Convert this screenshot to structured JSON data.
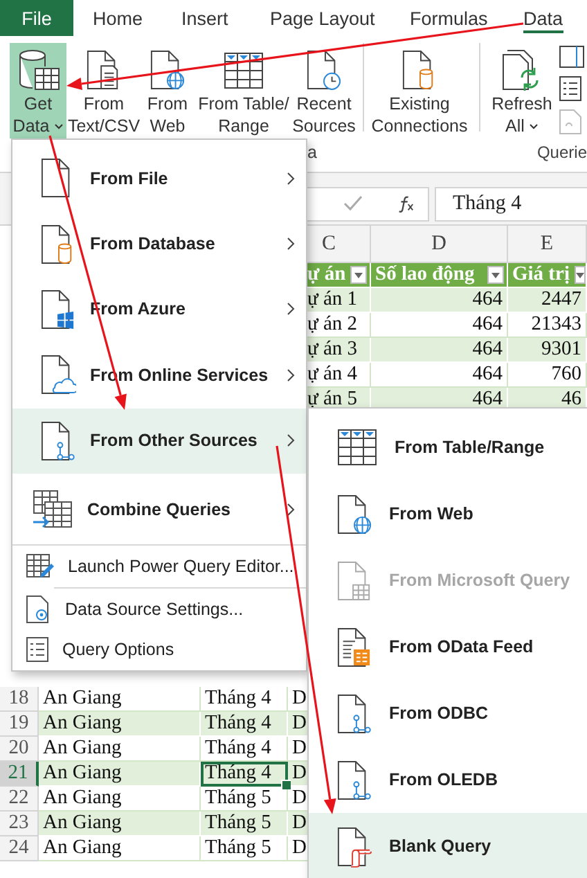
{
  "ribbon_tabs": [
    {
      "label": "File",
      "kind": "backstage",
      "selected": false
    },
    {
      "label": "Home",
      "kind": "tab",
      "selected": false
    },
    {
      "label": "Insert",
      "kind": "tab",
      "selected": false
    },
    {
      "label": "Page Layout",
      "kind": "tab",
      "selected": false
    },
    {
      "label": "Formulas",
      "kind": "tab",
      "selected": false
    },
    {
      "label": "Data",
      "kind": "tab",
      "selected": true
    }
  ],
  "ribbon": {
    "buttons": [
      {
        "lines": [
          "Get",
          "Data"
        ],
        "dropdown": true,
        "selected": true
      },
      {
        "lines": [
          "From",
          "Text/CSV"
        ],
        "dropdown": false,
        "selected": false
      },
      {
        "lines": [
          "From",
          "Web"
        ],
        "dropdown": false,
        "selected": false
      },
      {
        "lines": [
          "From Table/",
          "Range"
        ],
        "dropdown": false,
        "selected": false
      },
      {
        "lines": [
          "Recent",
          "Sources"
        ],
        "dropdown": false,
        "selected": false
      },
      {
        "lines": [
          "Existing",
          "Connections"
        ],
        "dropdown": false,
        "selected": false
      },
      {
        "lines": [
          "Refresh",
          "All"
        ],
        "dropdown": true,
        "selected": false
      }
    ],
    "group_labels": [
      "a",
      "Querie"
    ]
  },
  "formula_bar": {
    "value": "Tháng 4"
  },
  "sheet": {
    "column_headers": [
      "C",
      "D",
      "E"
    ],
    "table_headers": [
      "ự án",
      "Số lao động",
      "Giá trị"
    ],
    "upper_rows": [
      [
        "ự án 1",
        "464",
        "2447"
      ],
      [
        "ự án 2",
        "464",
        "21343"
      ],
      [
        "ự án 3",
        "464",
        "9301"
      ],
      [
        "ự án 4",
        "464",
        "760"
      ],
      [
        "ự án 5",
        "464",
        "46"
      ]
    ],
    "lower_rows": [
      {
        "row": "18",
        "cells": [
          "An Giang",
          "Tháng 4",
          "D"
        ],
        "selected": false
      },
      {
        "row": "19",
        "cells": [
          "An Giang",
          "Tháng 4",
          "D"
        ],
        "selected": false
      },
      {
        "row": "20",
        "cells": [
          "An Giang",
          "Tháng 4",
          "D"
        ],
        "selected": false
      },
      {
        "row": "21",
        "cells": [
          "An Giang",
          "Tháng 4",
          "D"
        ],
        "selected": true
      },
      {
        "row": "22",
        "cells": [
          "An Giang",
          "Tháng 5",
          "D"
        ],
        "selected": false
      },
      {
        "row": "23",
        "cells": [
          "An Giang",
          "Tháng 5",
          "D"
        ],
        "selected": false
      },
      {
        "row": "24",
        "cells": [
          "An Giang",
          "Tháng 5",
          "D"
        ],
        "selected": false
      }
    ]
  },
  "get_data_menu": {
    "sources": [
      {
        "label": "From File",
        "submenu": true,
        "selected": false
      },
      {
        "label": "From Database",
        "submenu": true,
        "selected": false
      },
      {
        "label": "From Azure",
        "submenu": true,
        "selected": false
      },
      {
        "label": "From Online Services",
        "submenu": true,
        "selected": false
      },
      {
        "label": "From Other Sources",
        "submenu": true,
        "selected": true
      },
      {
        "label": "Combine Queries",
        "submenu": true,
        "selected": false
      }
    ],
    "commands": [
      "Launch Power Query Editor...",
      "Data Source Settings...",
      "Query Options"
    ]
  },
  "other_sources_menu": {
    "items": [
      {
        "label": "From Table/Range",
        "disabled": false,
        "selected": false
      },
      {
        "label": "From Web",
        "disabled": false,
        "selected": false
      },
      {
        "label": "From Microsoft Query",
        "disabled": true,
        "selected": false
      },
      {
        "label": "From OData Feed",
        "disabled": false,
        "selected": false
      },
      {
        "label": "From ODBC",
        "disabled": false,
        "selected": false
      },
      {
        "label": "From OLEDB",
        "disabled": false,
        "selected": false
      },
      {
        "label": "Blank Query",
        "disabled": false,
        "selected": true
      }
    ]
  }
}
